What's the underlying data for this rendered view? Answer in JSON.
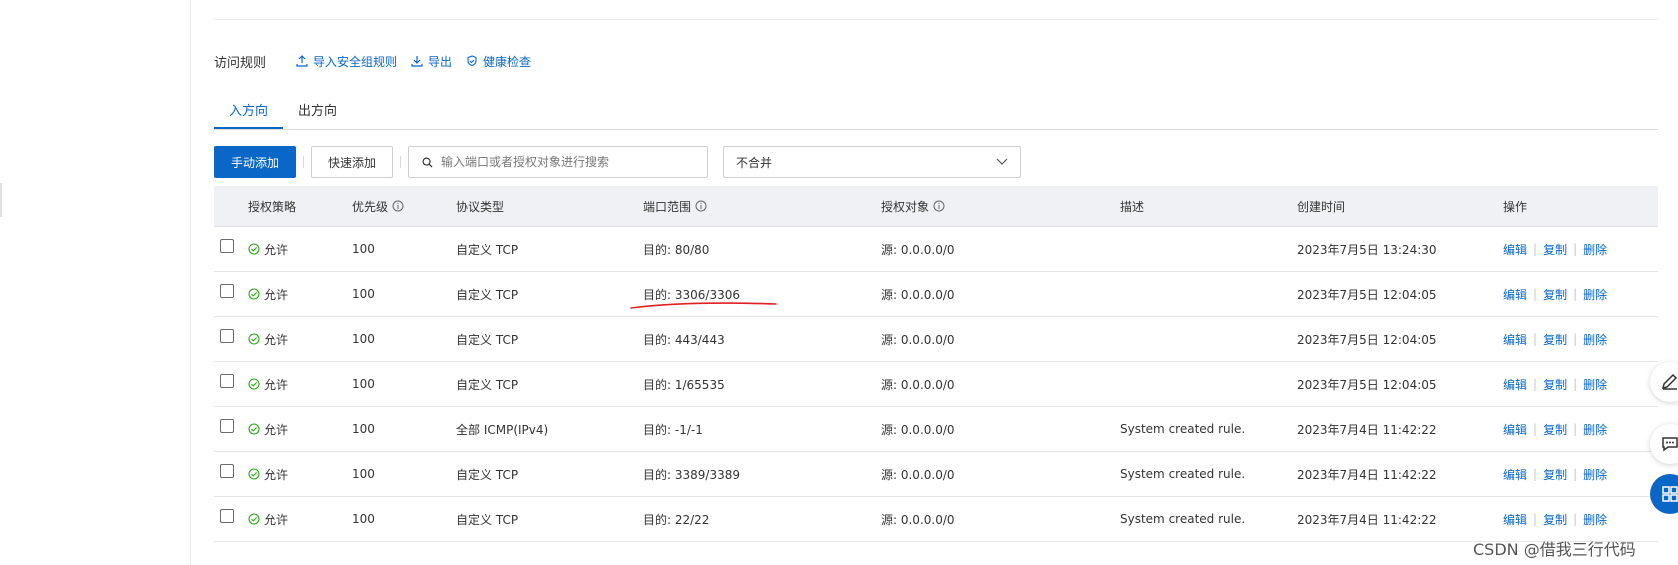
{
  "header": {
    "title": "访问规则",
    "links": [
      {
        "label": "导入安全组规则",
        "icon": "upload-icon"
      },
      {
        "label": "导出",
        "icon": "download-icon"
      },
      {
        "label": "健康检查",
        "icon": "shield-check-icon"
      }
    ]
  },
  "tabs": [
    {
      "label": "入方向",
      "active": true
    },
    {
      "label": "出方向",
      "active": false
    }
  ],
  "toolbar": {
    "add_manual": "手动添加",
    "add_quick": "快速添加",
    "search_placeholder": "输入端口或者授权对象进行搜索",
    "merge_select": "不合并"
  },
  "table": {
    "columns": [
      "授权策略",
      "优先级",
      "协议类型",
      "端口范围",
      "授权对象",
      "描述",
      "创建时间",
      "操作"
    ],
    "rows": [
      {
        "policy": "允许",
        "priority": "100",
        "protocol": "自定义 TCP",
        "port": "目的: 80/80",
        "source": "源: 0.0.0.0/0",
        "desc": "",
        "time": "2023年7月5日 13:24:30"
      },
      {
        "policy": "允许",
        "priority": "100",
        "protocol": "自定义 TCP",
        "port": "目的: 3306/3306",
        "source": "源: 0.0.0.0/0",
        "desc": "",
        "time": "2023年7月5日 12:04:05"
      },
      {
        "policy": "允许",
        "priority": "100",
        "protocol": "自定义 TCP",
        "port": "目的: 443/443",
        "source": "源: 0.0.0.0/0",
        "desc": "",
        "time": "2023年7月5日 12:04:05"
      },
      {
        "policy": "允许",
        "priority": "100",
        "protocol": "自定义 TCP",
        "port": "目的: 1/65535",
        "source": "源: 0.0.0.0/0",
        "desc": "",
        "time": "2023年7月5日 12:04:05"
      },
      {
        "policy": "允许",
        "priority": "100",
        "protocol": "全部 ICMP(IPv4)",
        "port": "目的: -1/-1",
        "source": "源: 0.0.0.0/0",
        "desc": "System created rule.",
        "time": "2023年7月4日 11:42:22"
      },
      {
        "policy": "允许",
        "priority": "100",
        "protocol": "自定义 TCP",
        "port": "目的: 3389/3389",
        "source": "源: 0.0.0.0/0",
        "desc": "System created rule.",
        "time": "2023年7月4日 11:42:22"
      },
      {
        "policy": "允许",
        "priority": "100",
        "protocol": "自定义 TCP",
        "port": "目的: 22/22",
        "source": "源: 0.0.0.0/0",
        "desc": "System created rule.",
        "time": "2023年7月4日 11:42:22"
      }
    ],
    "ops": [
      "编辑",
      "复制",
      "删除"
    ]
  },
  "floating": [
    "edit-icon",
    "chat-icon",
    "apps-icon"
  ],
  "watermark": "CSDN @借我三行代码",
  "colors": {
    "accent": "#0b67c7",
    "allow": "#2aa515",
    "annotation": "#e02020",
    "header_bg": "#eff1f4"
  }
}
